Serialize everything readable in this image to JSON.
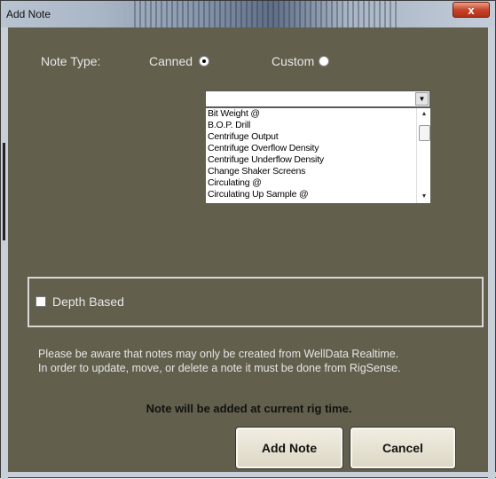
{
  "window": {
    "title": "Add Note",
    "close_glyph": "x"
  },
  "note_type": {
    "label": "Note Type:",
    "options": [
      {
        "label": "Canned",
        "selected": true
      },
      {
        "label": "Custom",
        "selected": false
      }
    ]
  },
  "canned_dropdown": {
    "value": "",
    "items": [
      "Bit Weight @",
      "B.O.P. Drill",
      "Centrifuge Output",
      "Centrifuge Overflow Density",
      "Centrifuge Underflow Density",
      "Change Shaker Screens",
      "Circulating @",
      "Circulating Up Sample @"
    ]
  },
  "depth_based": {
    "label": "Depth Based",
    "checked": false
  },
  "info_lines": [
    "Please be aware that notes may only be created from WellData Realtime.",
    "In order to update, move, or delete a note it must be done from RigSense."
  ],
  "notice": "Note will be added at current rig time.",
  "buttons": {
    "add_note": "Add Note",
    "cancel": "Cancel"
  },
  "icons": {
    "radio": "radio-icon",
    "dropdown_arrow": "chevron-down-icon",
    "close": "close-icon"
  },
  "colors": {
    "panel_bg": "#625f4c",
    "button_bg": "#e8e4d4"
  }
}
